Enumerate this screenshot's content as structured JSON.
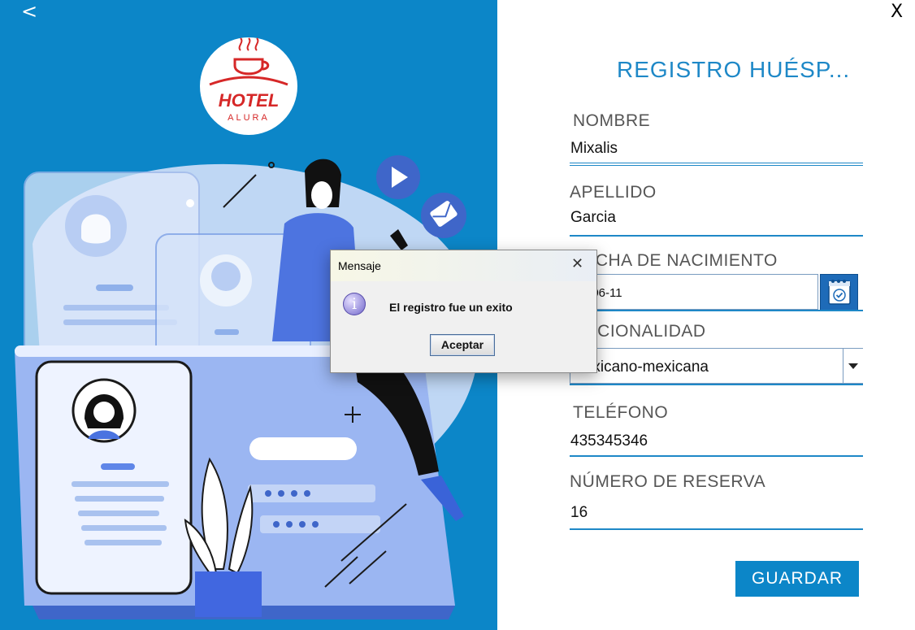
{
  "window": {
    "back_label": "<",
    "close_label": "X"
  },
  "logo": {
    "line1": "HOTEL",
    "line2": "ALURA"
  },
  "form": {
    "title": "REGISTRO HUÉSP...",
    "nombre": {
      "label": "NOMBRE",
      "value": "Mixalis"
    },
    "apellido": {
      "label": "APELLIDO",
      "value": "Garcia"
    },
    "fecha": {
      "label": "FECHA DE NACIMIENTO",
      "value": "2022-06-11",
      "visible_value": "2-06-11"
    },
    "nacionalidad": {
      "label": "NACIONALIDAD",
      "value": "mexicano-mexicana"
    },
    "telefono": {
      "label": "TELÉFONO",
      "value": "435345346"
    },
    "reserva": {
      "label": "NÚMERO DE RESERVA",
      "value": "16"
    },
    "guardar_label": "GUARDAR"
  },
  "dialog": {
    "title": "Mensaje",
    "close_label": "✕",
    "icon": "info-icon",
    "message": "El registro fue un exito",
    "ok_label": "Aceptar"
  },
  "colors": {
    "panel_blue": "#0c86c8",
    "accent": "#1e88c7",
    "button": "#0c86c8"
  }
}
